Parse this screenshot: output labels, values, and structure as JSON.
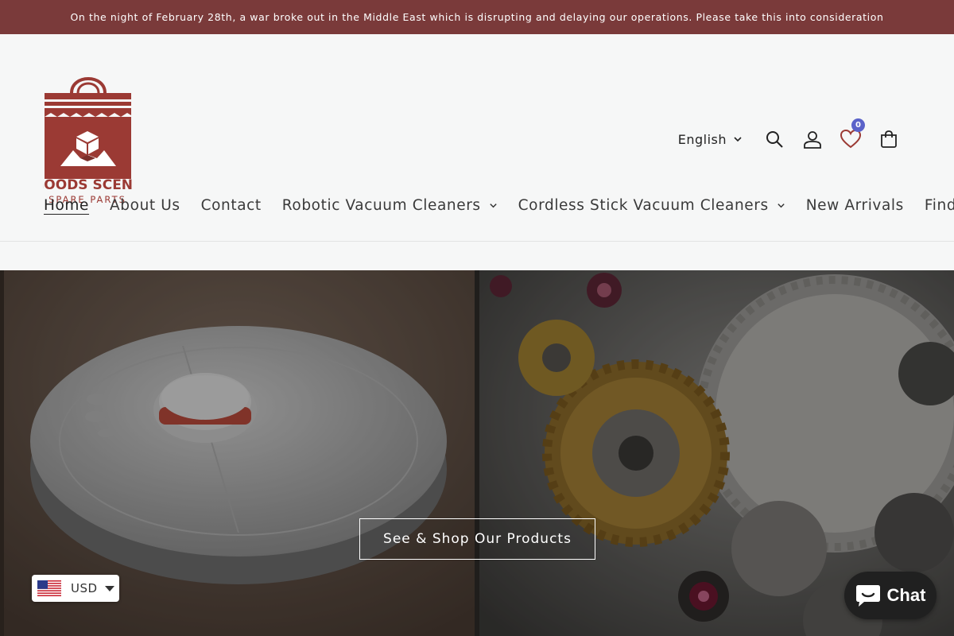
{
  "announcement": "On the night of February 28th, a war broke out in the Middle East which is disrupting and delaying our operations. Please take this into consideration",
  "brand": {
    "name": "GOODS SCENE",
    "tagline": "SPARE PARTS",
    "color": "#9b3a34"
  },
  "header": {
    "language": "English",
    "wishlist_count": "0",
    "icons": [
      "search-icon",
      "account-icon",
      "heart-icon",
      "cart-icon"
    ]
  },
  "nav": {
    "items": [
      {
        "label": "Home",
        "active": true
      },
      {
        "label": "About Us"
      },
      {
        "label": "Contact"
      },
      {
        "label": "Robotic Vacuum Cleaners",
        "dropdown": true
      },
      {
        "label": "Cordless Stick Vacuum Cleaners",
        "dropdown": true
      },
      {
        "label": "New Arrivals"
      },
      {
        "label": "Find"
      }
    ]
  },
  "hero": {
    "button_label": "See & Shop Our Products"
  },
  "currency": {
    "code": "USD",
    "flag": "us-flag-icon"
  },
  "chat": {
    "label": "Chat"
  },
  "colors": {
    "announcement_bg": "#7a3a3a",
    "badge": "#5a62c9",
    "chat_bg": "#202020"
  }
}
